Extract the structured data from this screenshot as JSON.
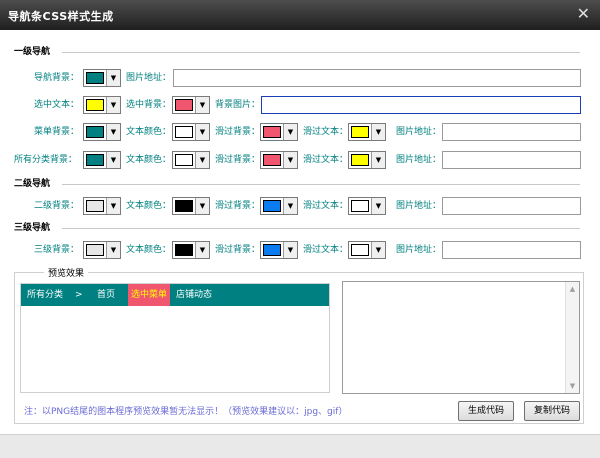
{
  "window": {
    "title": "导航条CSS样式生成",
    "close_glyph": "✕"
  },
  "sections": {
    "level1": "一级导航",
    "level2": "二级导航",
    "level3": "三级导航"
  },
  "labels": {
    "nav_bg": "导航背景：",
    "image_url": "图片地址：",
    "selected_text": "选中文本：",
    "selected_bg": "选中背景：",
    "bg_image": "背景图片：",
    "menu_bg": "菜单背景：",
    "text_color": "文本颜色：",
    "hover_bg": "滑过背景：",
    "hover_text": "滑过文本：",
    "all_cat_bg": "所有分类背景：",
    "level2_bg": "二级背景：",
    "level3_bg": "三级背景："
  },
  "colors": {
    "nav_bg": "#008080",
    "selected_text": "#ffff00",
    "selected_bg": "#f0566e",
    "menu_bg": "#008080",
    "menu_text": "#ffffff",
    "menu_hover_bg": "#f0566e",
    "menu_hover_text": "#ffff00",
    "allcat_bg": "#008080",
    "allcat_text": "#ffffff",
    "allcat_hover_bg": "#f0566e",
    "allcat_hover_text": "#ffff00",
    "l2_bg": "#e6e6e6",
    "l2_text": "#000000",
    "l2_hover_bg": "#0a7cf0",
    "l2_hover_text": "#ffffff",
    "l3_bg": "#e6e6e6",
    "l3_text": "#000000",
    "l3_hover_bg": "#0a7cf0",
    "l3_hover_text": "#ffffff"
  },
  "preview": {
    "group_title": "预览效果",
    "nav_items": [
      "所有分类",
      ">",
      "首页",
      "选中菜单",
      "店铺动态"
    ]
  },
  "note": "注：以PNG结尾的图本程序预览效果暂无法显示！（预览效果建议以：jpg、gif）",
  "buttons": {
    "generate": "生成代码",
    "copy": "复制代码"
  },
  "icons": {
    "dropdown": "▼",
    "scroll_up": "▲",
    "scroll_down": "▼"
  }
}
